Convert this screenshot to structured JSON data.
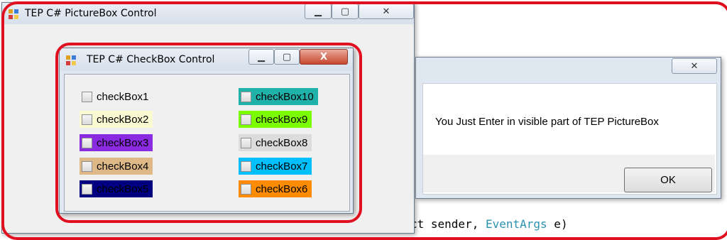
{
  "code_editor": {
    "line_text_prefix": "ct sender, ",
    "line_type": "EventArgs",
    "line_suffix": " e)"
  },
  "picturebox_window": {
    "title": "TEP C# PictureBox Control"
  },
  "checkbox_window": {
    "title": "TEP C# CheckBox Control",
    "left_column": [
      {
        "label": "checkBox1",
        "bg": "#f0f0f0",
        "fg": "#000000"
      },
      {
        "label": "checkBox2",
        "bg": "#fafad2",
        "fg": "#000000"
      },
      {
        "label": "checkBox3",
        "bg": "#8a2be2",
        "fg": "#000000"
      },
      {
        "label": "checkBox4",
        "bg": "#deb887",
        "fg": "#000000"
      },
      {
        "label": "checkBox5",
        "bg": "#000080",
        "fg": "#000000"
      }
    ],
    "right_column": [
      {
        "label": "checkBox10",
        "bg": "#20b2aa",
        "fg": "#000000"
      },
      {
        "label": "checkBox9",
        "bg": "#7cfc00",
        "fg": "#000000"
      },
      {
        "label": "checkBox8",
        "bg": "#dcdcdc",
        "fg": "#000000"
      },
      {
        "label": "checkBox7",
        "bg": "#00bfff",
        "fg": "#000000"
      },
      {
        "label": "checkBox6",
        "bg": "#ff8c00",
        "fg": "#000000"
      }
    ]
  },
  "message_box": {
    "message": "You Just Enter in visible part of TEP PictureBox",
    "ok_label": "OK"
  },
  "icons": {
    "minimize": "minimize-icon",
    "maximize": "maximize-icon",
    "close": "close-icon",
    "app": "app-icon"
  },
  "colors": {
    "highlight_ring": "#e01020"
  }
}
